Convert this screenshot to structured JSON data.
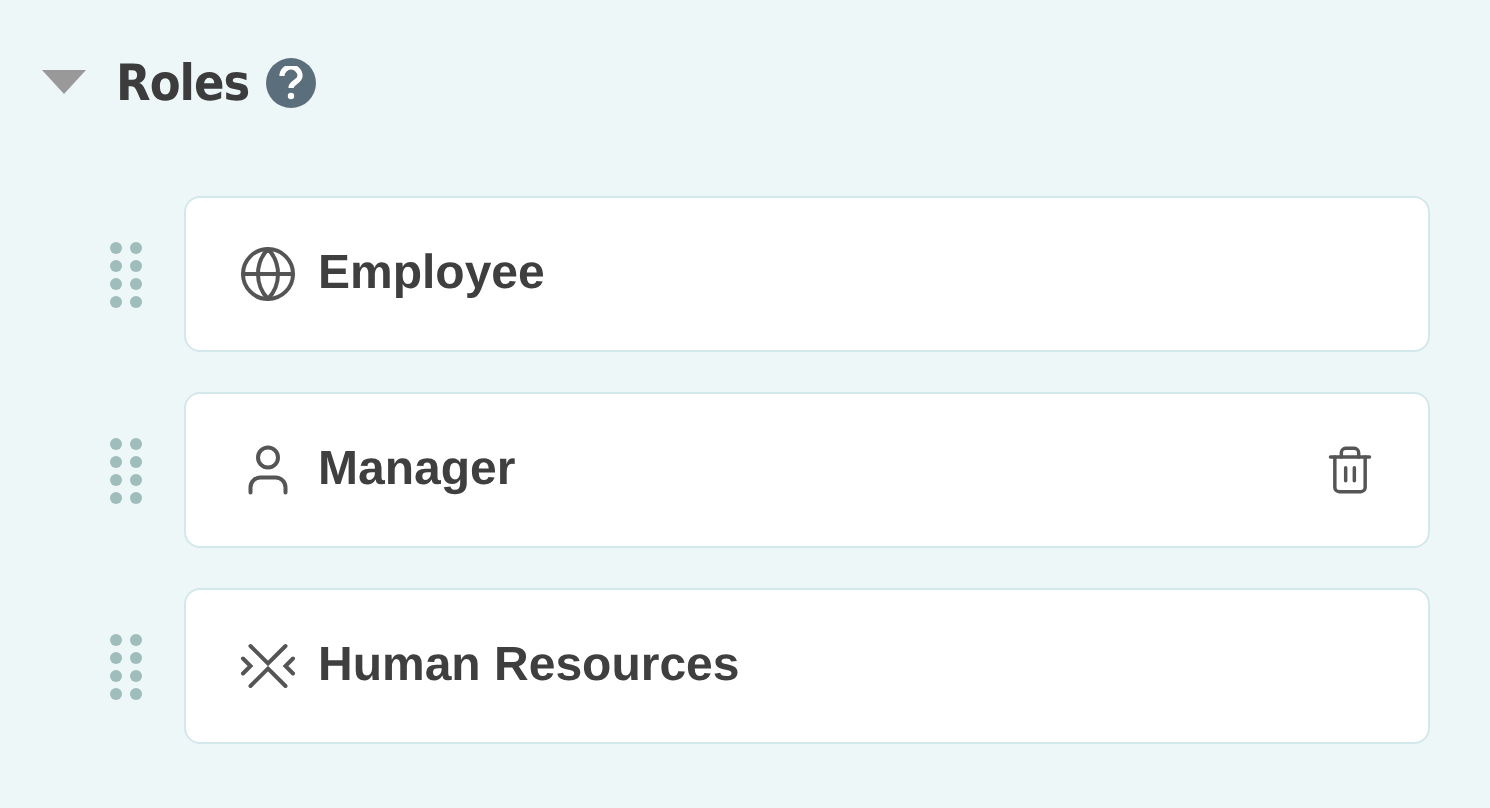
{
  "section": {
    "title": "Roles",
    "expanded": true
  },
  "roles": [
    {
      "label": "Employee",
      "kind": "globe",
      "delete_visible": false
    },
    {
      "label": "Manager",
      "kind": "user",
      "delete_visible": true
    },
    {
      "label": "Human Resources",
      "kind": "arrows",
      "delete_visible": false
    }
  ]
}
